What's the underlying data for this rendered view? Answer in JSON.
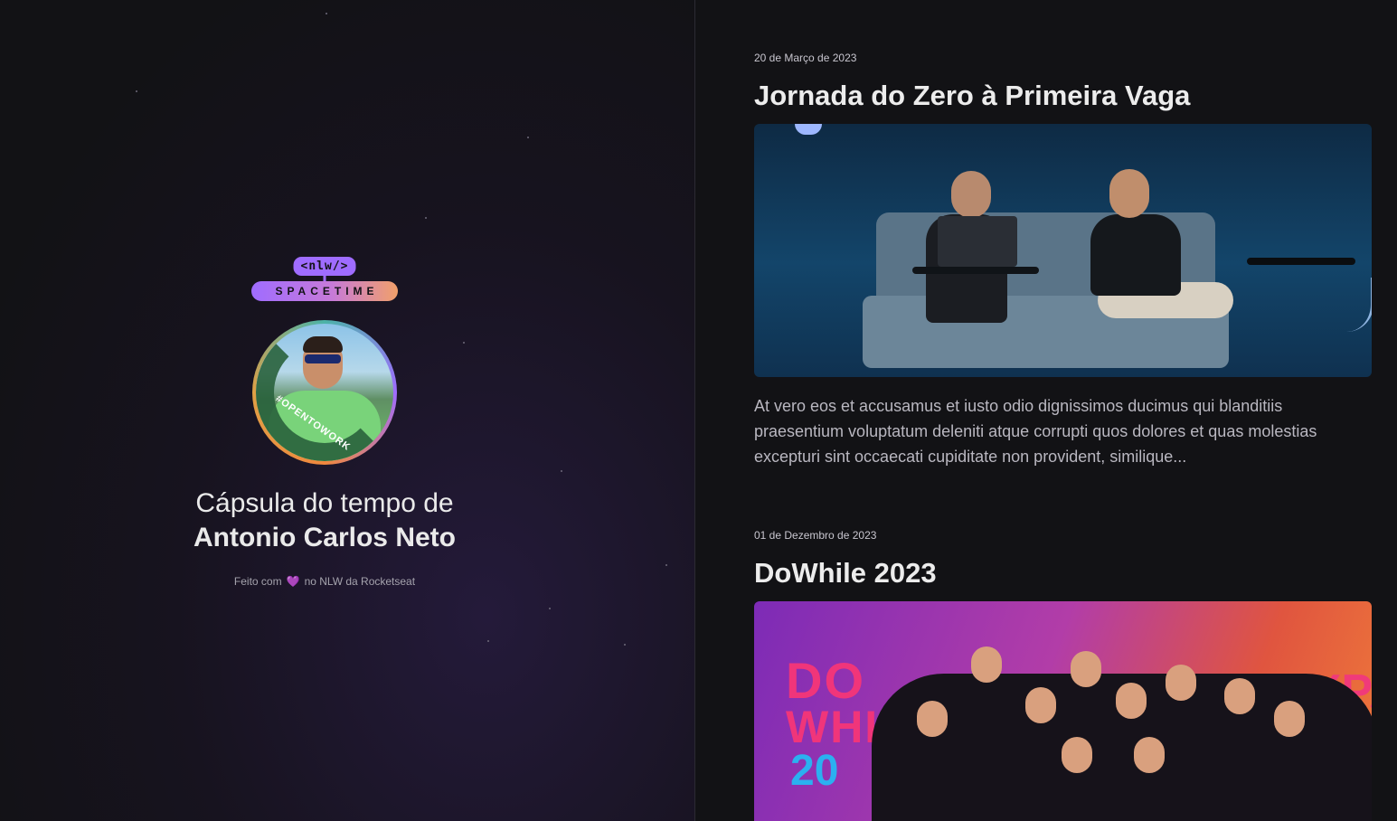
{
  "profile": {
    "logo_top": "<nlw/>",
    "logo_bottom": "SPACETIME",
    "avatar_badge": "#OPENTOWORK",
    "title_prefix": "Cápsula do tempo de",
    "name": "Antonio Carlos Neto",
    "footer_before": "Feito com",
    "footer_heart": "💜",
    "footer_after": "no NLW da Rocketseat"
  },
  "memories": [
    {
      "date": "20 de Março de 2023",
      "title": "Jornada do Zero à Primeira Vaga",
      "excerpt": "At vero eos et accusamus et iusto odio dignissimos ducimus qui blanditiis praesentium voluptatum deleniti atque corrupti quos dolores et quas molestias excepturi sint occaecati cupiditate non provident, similique..."
    },
    {
      "date": "01 de Dezembro de 2023",
      "title": "DoWhile 2023",
      "image_text": [
        "DO",
        "WHI",
        "20",
        "EXPA"
      ]
    }
  ],
  "colors": {
    "background": "#121215",
    "accent_purple": "#9f6cff",
    "accent_orange": "#f1a06a"
  }
}
